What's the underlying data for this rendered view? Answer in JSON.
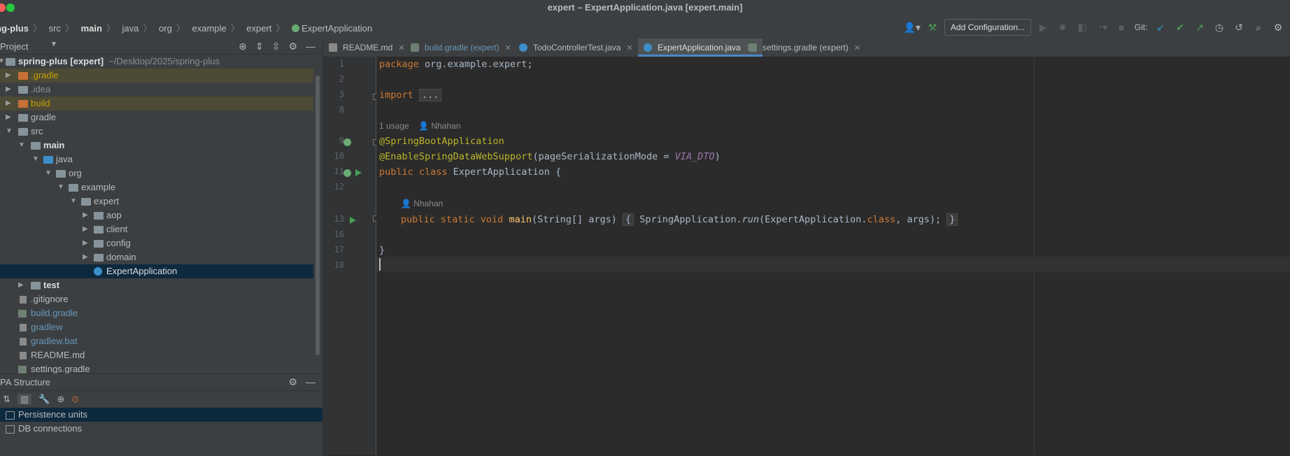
{
  "window": {
    "title": "expert – ExpertApplication.java [expert.main]"
  },
  "breadcrumb": [
    "ng-plus",
    "src",
    "main",
    "java",
    "org",
    "example",
    "expert",
    "ExpertApplication"
  ],
  "toolbar": {
    "add_config": "Add Configuration...",
    "git_label": "Git:"
  },
  "project_panel": {
    "title": "Project",
    "tree": [
      {
        "label": "spring-plus [expert]",
        "path": "~/Desktop/2025/spring-plus"
      },
      {
        "label": ".gradle"
      },
      {
        "label": ".idea"
      },
      {
        "label": "build"
      },
      {
        "label": "gradle"
      },
      {
        "label": "src"
      },
      {
        "label": "main"
      },
      {
        "label": "java"
      },
      {
        "label": "org"
      },
      {
        "label": "example"
      },
      {
        "label": "expert"
      },
      {
        "label": "aop"
      },
      {
        "label": "client"
      },
      {
        "label": "config"
      },
      {
        "label": "domain"
      },
      {
        "label": "ExpertApplication"
      },
      {
        "label": "test"
      },
      {
        "label": ".gitignore"
      },
      {
        "label": "build.gradle"
      },
      {
        "label": "gradlew"
      },
      {
        "label": "gradlew.bat"
      },
      {
        "label": "README.md"
      },
      {
        "label": "settings.gradle"
      }
    ]
  },
  "jpa_panel": {
    "title": "PA Structure",
    "items": [
      "Persistence units",
      "DB connections"
    ]
  },
  "tabs": [
    {
      "label": "README.md"
    },
    {
      "label": "build.gradle (expert)"
    },
    {
      "label": "TodoControllerTest.java"
    },
    {
      "label": "ExpertApplication.java"
    },
    {
      "label": "settings.gradle (expert)"
    }
  ],
  "editor": {
    "line_numbers": [
      "1",
      "2",
      "3",
      "8",
      "9",
      "10",
      "11",
      "12",
      "13",
      "16",
      "17",
      "18"
    ],
    "usage_hint": "1 usage",
    "author_hint": "Nhahan",
    "author_hint_2": "Nhahan",
    "code": {
      "l1_kw": "package",
      "l1_rest": " org.example.expert;",
      "l3_kw": "import",
      "l3_fold": "...",
      "l9_ann": "@SpringBootApplication",
      "l10_ann": "@EnableSpringDataWebSupport",
      "l10_a": "(pageSerializationMode = ",
      "l10_const": "VIA_DTO",
      "l10_b": ")",
      "l11_kw": "public class",
      "l11_rest": " ExpertApplication {",
      "l13_kw": "public static void",
      "l13_fn": "main",
      "l13_args": "(String[] args)",
      "l13_ob": "{",
      "l13_a": " SpringApplication.",
      "l13_run": "run",
      "l13_b": "(ExpertApplication.",
      "l13_cls": "class",
      "l13_c": ", args);",
      "l13_cb": "}",
      "l17": "}"
    }
  }
}
